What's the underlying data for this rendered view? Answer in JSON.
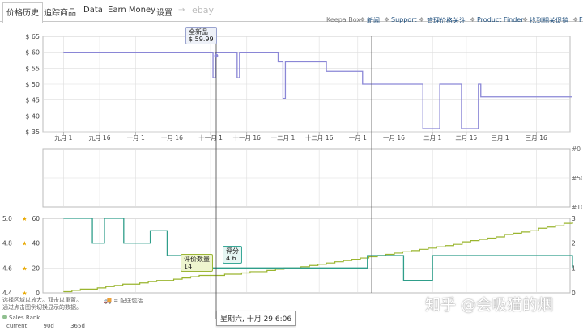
{
  "tabs": [
    {
      "label": "价格历史",
      "active": true
    },
    {
      "label": "追踪商品"
    },
    {
      "label": "Data"
    },
    {
      "label": "Earn Money"
    },
    {
      "label": "设置"
    },
    {
      "label": "→"
    },
    {
      "label": "ebay"
    }
  ],
  "links": [
    "Keepa Box",
    "新闻",
    "Support",
    "管理价格关注",
    "Product Finder",
    "找到相关促销",
    "F"
  ],
  "link_separator": "❖",
  "price_chart": {
    "y_ticks": [
      "$ 65",
      "$ 60",
      "$ 55",
      "$ 50",
      "$ 45",
      "$ 40",
      "$ 35"
    ],
    "x_ticks": [
      "九月 1",
      "九月 16",
      "十月 1",
      "十月 16",
      "十一月 1",
      "十一月 16",
      "十二月 1",
      "十二月 16",
      "一月 1",
      "一月 16",
      "二月 1",
      "二月 15",
      "三月 1",
      "三月 16"
    ],
    "annotation": {
      "label": "全新品",
      "value": "$ 59.99"
    }
  },
  "rank_chart": {
    "right_ticks": [
      "#0",
      "#50",
      "#100"
    ]
  },
  "rating_chart": {
    "left_ticks": [
      "5.0",
      "4.8",
      "4.6",
      "4.4"
    ],
    "left_ticks2": [
      "60",
      "40",
      "20",
      "0"
    ],
    "right_ticks": [
      "3",
      "2",
      "1",
      "0"
    ],
    "rating_count_annotation": {
      "label": "评价数量",
      "value": "14"
    },
    "rating_annotation": {
      "label": "评分",
      "value": "4.6"
    }
  },
  "date_tooltip": "星期六, 十月 29 6:06",
  "footer": {
    "hint_line1": "选择区域以放大。双击以重置。",
    "hint_line2": "通过点击图例切换显示的数据。",
    "shipping_label": "= 配送包括",
    "legend_sales_rank": "Sales Rank",
    "range_current": "current",
    "range_90": "90d",
    "range_365": "365d"
  },
  "watermark": "知乎 @会吸猫的烟",
  "colors": {
    "new_price": "#8a86d6",
    "rating": "#9ab52e",
    "review_count": "#2f9e8a",
    "crosshair": "#444444",
    "grid": "#dddddd"
  },
  "chart_data": [
    {
      "type": "line",
      "name_hint": "price history",
      "ylabel": "",
      "ylim": [
        35,
        65
      ],
      "series": [
        {
          "name": "全新品",
          "points": [
            [
              "九月 1",
              59.99
            ],
            [
              "十一月 1",
              59.99
            ],
            [
              "十一月 2",
              52
            ],
            [
              "十一月 3",
              59.99
            ],
            [
              "十一月 11",
              59.99
            ],
            [
              "十一月 12",
              52
            ],
            [
              "十一月 13",
              59.99
            ],
            [
              "十一月 28",
              59.99
            ],
            [
              "十一月 29",
              57
            ],
            [
              "十二月 1",
              45.5
            ],
            [
              "十二月 2",
              57
            ],
            [
              "十二月 18",
              57
            ],
            [
              "十二月 19",
              54
            ],
            [
              "一月 1",
              54
            ],
            [
              "一月 3",
              50
            ],
            [
              "一月 22",
              50
            ],
            [
              "一月 28",
              36
            ],
            [
              "二月 3",
              36
            ],
            [
              "二月 4",
              50
            ],
            [
              "二月 12",
              50
            ],
            [
              "二月 13",
              36
            ],
            [
              "二月 19",
              36
            ],
            [
              "二月 20",
              50
            ],
            [
              "二月 21",
              46
            ],
            [
              "三月 31",
              46
            ]
          ]
        }
      ]
    },
    {
      "type": "line",
      "name_hint": "sales rank",
      "ylim": [
        0,
        100
      ],
      "series": []
    },
    {
      "type": "line",
      "name_hint": "ratings",
      "ylim": [
        4.4,
        5.0
      ],
      "series": [
        {
          "name": "评价数量",
          "points": [
            [
              "九月 1",
              1
            ],
            [
              "十月 29",
              14
            ],
            [
              "三月 31",
              57
            ]
          ]
        },
        {
          "name": "评分",
          "points": [
            [
              "九月 1",
              5.0
            ],
            [
              "九月 12",
              5.0
            ],
            [
              "九月 13",
              4.8
            ],
            [
              "九月 18",
              5.0
            ],
            [
              "九月 25",
              5.0
            ],
            [
              "九月 26",
              4.8
            ],
            [
              "十月 7",
              4.9
            ],
            [
              "十月 14",
              4.7
            ],
            [
              "十月 22",
              4.6
            ],
            [
              "十月 29",
              4.6
            ],
            [
              "一月 1",
              4.6
            ],
            [
              "一月 5",
              4.7
            ],
            [
              "一月 20",
              4.5
            ],
            [
              "二月 1",
              4.7
            ],
            [
              "三月 31",
              4.6
            ]
          ]
        }
      ]
    }
  ]
}
